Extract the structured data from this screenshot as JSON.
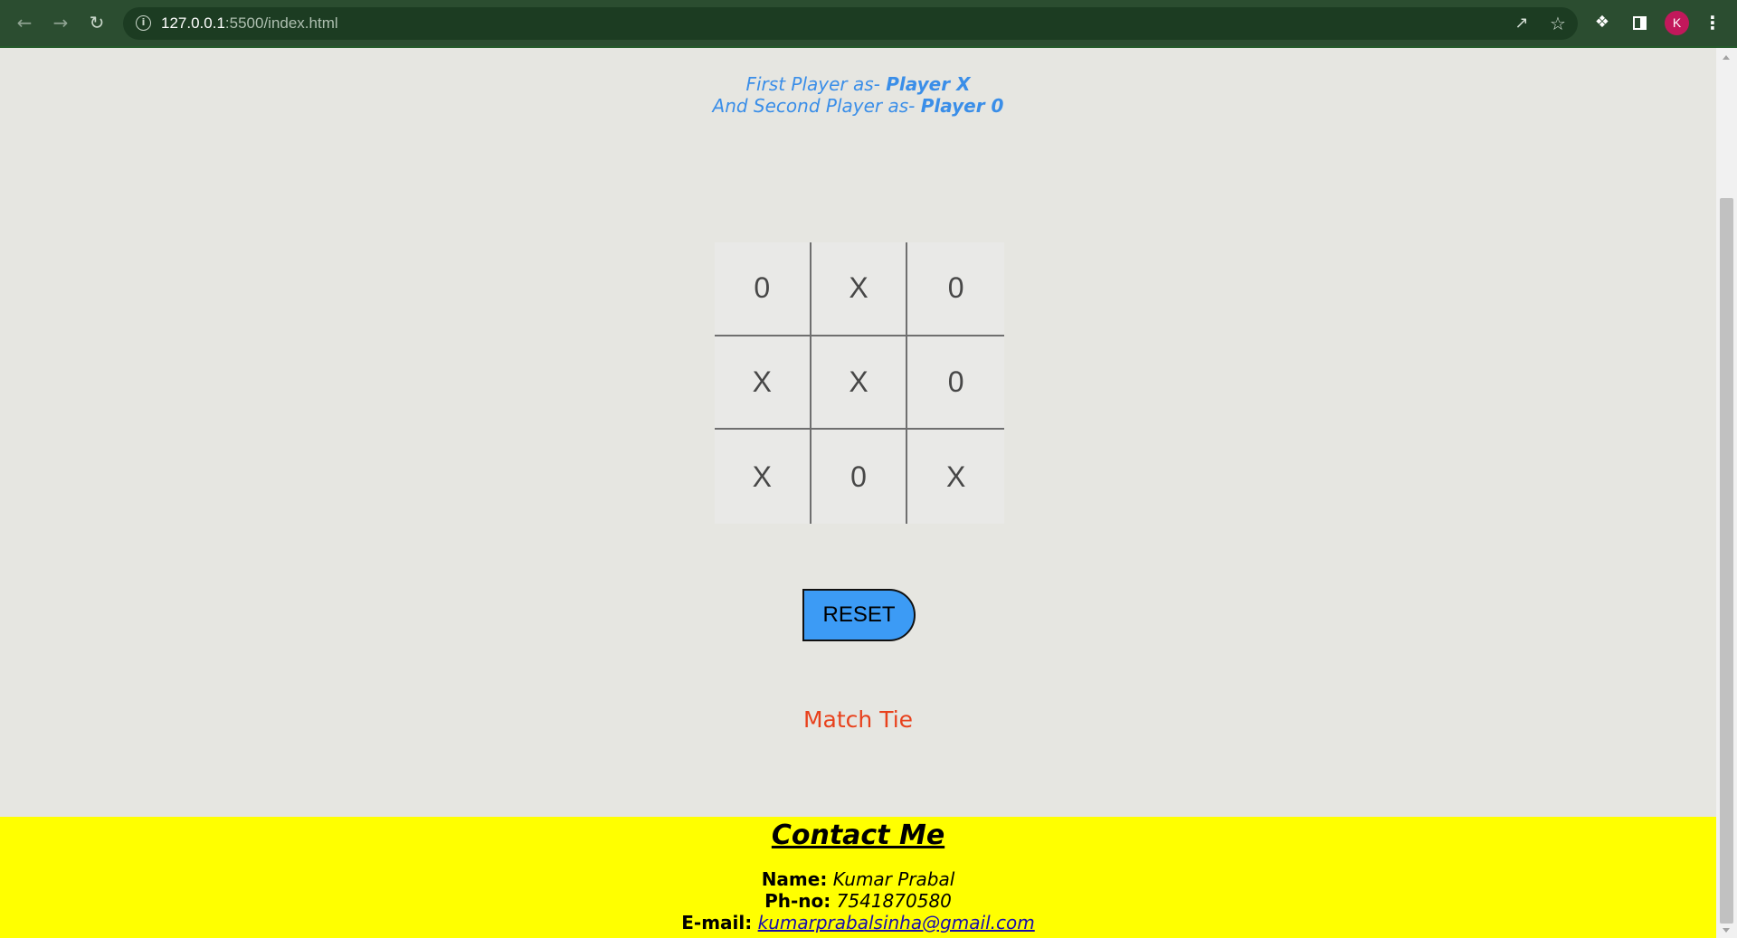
{
  "browser": {
    "url_host": "127.0.0.1",
    "url_path": ":5500/index.html",
    "avatar_letter": "K",
    "icons": [
      "back-arrow-icon",
      "forward-arrow-icon",
      "reload-icon",
      "info-icon",
      "share-icon",
      "star-icon",
      "extensions-icon",
      "side-panel-icon",
      "menu-icon"
    ]
  },
  "intro": {
    "first_prefix": "First Player as- ",
    "first_player": "Player X",
    "second_prefix": "And Second Player as- ",
    "second_player": "Player 0"
  },
  "board": {
    "cells": [
      "0",
      "X",
      "0",
      "X",
      "X",
      "0",
      "X",
      "0",
      "X"
    ]
  },
  "controls": {
    "reset_label": "RESET"
  },
  "status": {
    "message": "Match Tie"
  },
  "footer": {
    "heading": "Contact Me",
    "name_label": "Name:",
    "name_value": "Kumar Prabal",
    "phone_label": "Ph-no:",
    "phone_value": "7541870580",
    "email_label": "E-mail:",
    "email_value": "kumarprabalsinha@gmail.com"
  },
  "colors": {
    "chrome": "#2b4d30",
    "page_background": "#e6e6e1",
    "accent_blue": "#3a8ee8",
    "reset_button": "#3c9bf5",
    "status_red": "#e8411c",
    "footer_yellow": "#ffff00"
  }
}
